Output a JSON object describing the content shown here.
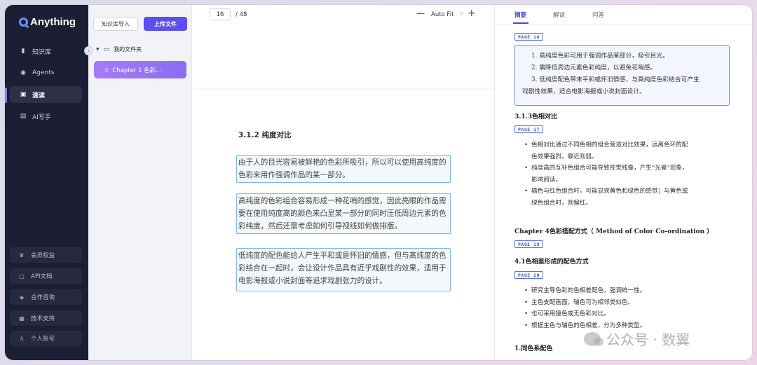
{
  "app": {
    "name": "Anything"
  },
  "sidebar": {
    "items": [
      {
        "label": "知识库",
        "icon": "book-icon"
      },
      {
        "label": "Agents",
        "icon": "robot-icon"
      },
      {
        "label": "速读",
        "icon": "reader-icon",
        "active": true
      },
      {
        "label": "AI写手",
        "icon": "pen-icon"
      }
    ],
    "bottom": [
      {
        "label": "会员权益",
        "icon": "crown-icon"
      },
      {
        "label": "API文档",
        "icon": "doc-icon"
      },
      {
        "label": "合作咨询",
        "icon": "handshake-icon"
      },
      {
        "label": "技术支持",
        "icon": "grid-icon"
      },
      {
        "label": "个人账号",
        "icon": "user-icon"
      }
    ]
  },
  "files": {
    "import_label": "知识库导入",
    "upload_label": "上传文件",
    "folder": "我的文件夹",
    "active_file": "Chapter 1 色彩..."
  },
  "viewer": {
    "page": "16",
    "total": "/ 48",
    "zoom": "Auto Fit",
    "section_title": "3.1.2  纯度对比",
    "paragraphs": [
      "由于人的目光容易被鲜艳的色彩所吸引，所以可以使用高纯度的色彩来用作强调作品的某一部分。",
      "高纯度的色彩组合容易形成一种花哨的感觉，因此亮眼的作品需要在使用纯度高的颜色来凸显某一部分的同时压低周边元素的色彩纯度，然后还需考虑如何引导视线如何做排版。",
      "低纯度的配色能给人产生平和或是怀旧的情感，但与高纯度的色彩结合在一起时，会让设计作品具有近乎戏剧性的效果，适用于电影海报或小说封面等追求戏剧张力的设计。"
    ]
  },
  "summary": {
    "tabs": [
      "摘要",
      "解读",
      "问答"
    ],
    "tag16": "PAGE 16",
    "quote": [
      "1. 高纯度色彩可用于强调作品某部分，吸引目光。",
      "2. 需降低周边元素色彩纯度，以避免花哨感。",
      "3. 低纯度配色带来平和或怀旧情感，与高纯度色彩结合可产生",
      "戏剧性效果，适合电影海报或小说封面设计。"
    ],
    "heading1": "3.1.3色相对比",
    "tag17": "PAGE 17",
    "list1": [
      "色相对比通过不同色相的组合营造对比效果，远离色环的配",
      "色效果强烈，靠近则弱。",
      "纯度高的互补色组合可能导致视觉残像，产生“光晕”现象，",
      "影响阅读。",
      "橘色与红色组合时，可能显现黄色和绿色的感觉；与黄色或",
      "绿色组合时，则偏红。"
    ],
    "chapter": "Chapter 4色彩搭配方式（ Method of Color Co-ordination ）",
    "tag19": "PAGE 19",
    "heading2": "4.1色相差形成的配色方式",
    "tag20": "PAGE 20",
    "list2": [
      "研究主导色彩的色相差配色，强调统一性。",
      "主色支配画面，辅色可为相邻类似色。",
      "也可采用撞色或无色彩对比。",
      "根据主色与辅色的色相差，分为多种类型。"
    ],
    "heading3": "1.同色系配色",
    "watermark": "公众号 · 数翼"
  },
  "colors": {
    "accent": "#5b4ef2",
    "sidebar_bg": "#1c1f33",
    "active_file": "#a67cf6"
  }
}
